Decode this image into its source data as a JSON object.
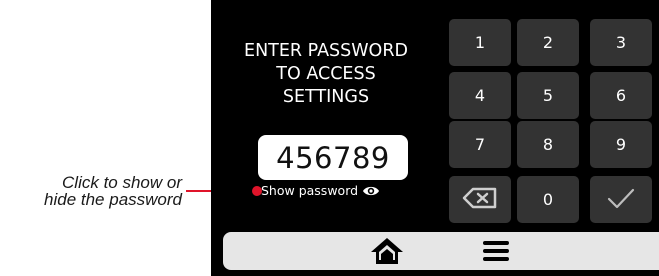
{
  "annotation": {
    "line1": "Click to show or",
    "line2": "hide the password"
  },
  "screen": {
    "prompt_line1": "ENTER PASSWORD",
    "prompt_line2": "TO ACCESS",
    "prompt_line3": "SETTINGS",
    "password_value": "456789",
    "show_password_label": "Show password",
    "show_password_icon": "eye-icon"
  },
  "keypad": {
    "k1": "1",
    "k2": "2",
    "k3": "3",
    "k4": "4",
    "k5": "5",
    "k6": "6",
    "k7": "7",
    "k8": "8",
    "k9": "9",
    "k0": "0",
    "backspace_icon": "backspace-icon",
    "confirm_icon": "checkmark-icon"
  },
  "nav": {
    "home_icon": "home-icon",
    "menu_icon": "menu-icon"
  },
  "colors": {
    "callout": "#e0142a",
    "screen_bg": "#000000",
    "key_bg": "#333333",
    "nav_bg": "#e6e6e6"
  }
}
